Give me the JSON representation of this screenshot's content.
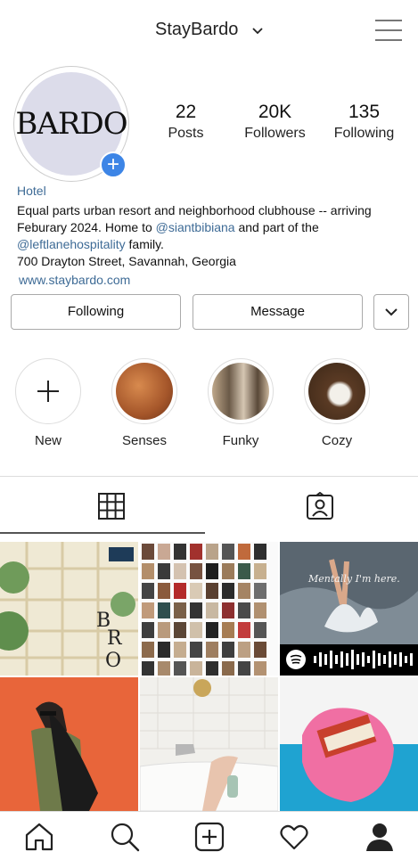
{
  "header": {
    "account_name": "StayBardo"
  },
  "profile": {
    "logo_text": "BARDO",
    "stats": [
      {
        "value": "22",
        "label": "Posts"
      },
      {
        "value": "20K",
        "label": "Followers"
      },
      {
        "value": "135",
        "label": "Following"
      }
    ],
    "category": "Hotel",
    "bio_line1": "Equal parts urban resort and neighborhood clubhouse -- arriving",
    "bio_line2_prefix": "Feburary 2024. Home to ",
    "bio_mention1": "@siantbibiana",
    "bio_line2_suffix": " and part of the",
    "bio_mention2": "@leftlanehospitality",
    "bio_line3_suffix": " family.",
    "bio_address": "700 Drayton Street, Savannah, Georgia",
    "website": "www.staybardo.com"
  },
  "actions": {
    "following_label": "Following",
    "message_label": "Message"
  },
  "highlights": [
    {
      "label": "New"
    },
    {
      "label": "Senses"
    },
    {
      "label": "Funky"
    },
    {
      "label": "Cozy"
    }
  ],
  "posts": {
    "post3_caption": "Mentally I'm here."
  },
  "colors": {
    "accent": "#3d85e6",
    "link": "#3e6b96"
  }
}
